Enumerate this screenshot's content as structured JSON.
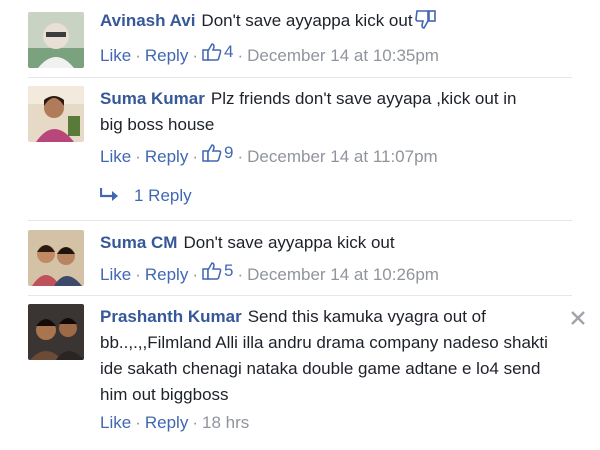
{
  "labels": {
    "like": "Like",
    "reply": "Reply",
    "separator": "·"
  },
  "comments": [
    {
      "author": "Avinash Avi",
      "text": "Don't save ayyappa kick out",
      "likes": "4",
      "time": "December 14 at 10:35pm"
    },
    {
      "author": "Suma Kumar",
      "text": "Plz friends don't save ayyapa ,kick out in big boss house",
      "likes": "9",
      "time": "December 14 at 11:07pm"
    },
    {
      "author": "Suma CM",
      "text": "Don't save ayyappa kick out",
      "likes": "5",
      "time": "December 14 at 10:26pm"
    },
    {
      "author": "Prashanth Kumar",
      "text": "Send this kamuka vyagra out of bb..,.,,Filmland Alli illa andru drama company nadeso shakti ide sakath chenagi nataka double game adtane e lo4 send him out biggboss",
      "time": "18 hrs"
    }
  ],
  "replies_link": "1 Reply",
  "colors": {
    "author": "#365899",
    "link": "#4267b2",
    "muted": "#90949c"
  }
}
